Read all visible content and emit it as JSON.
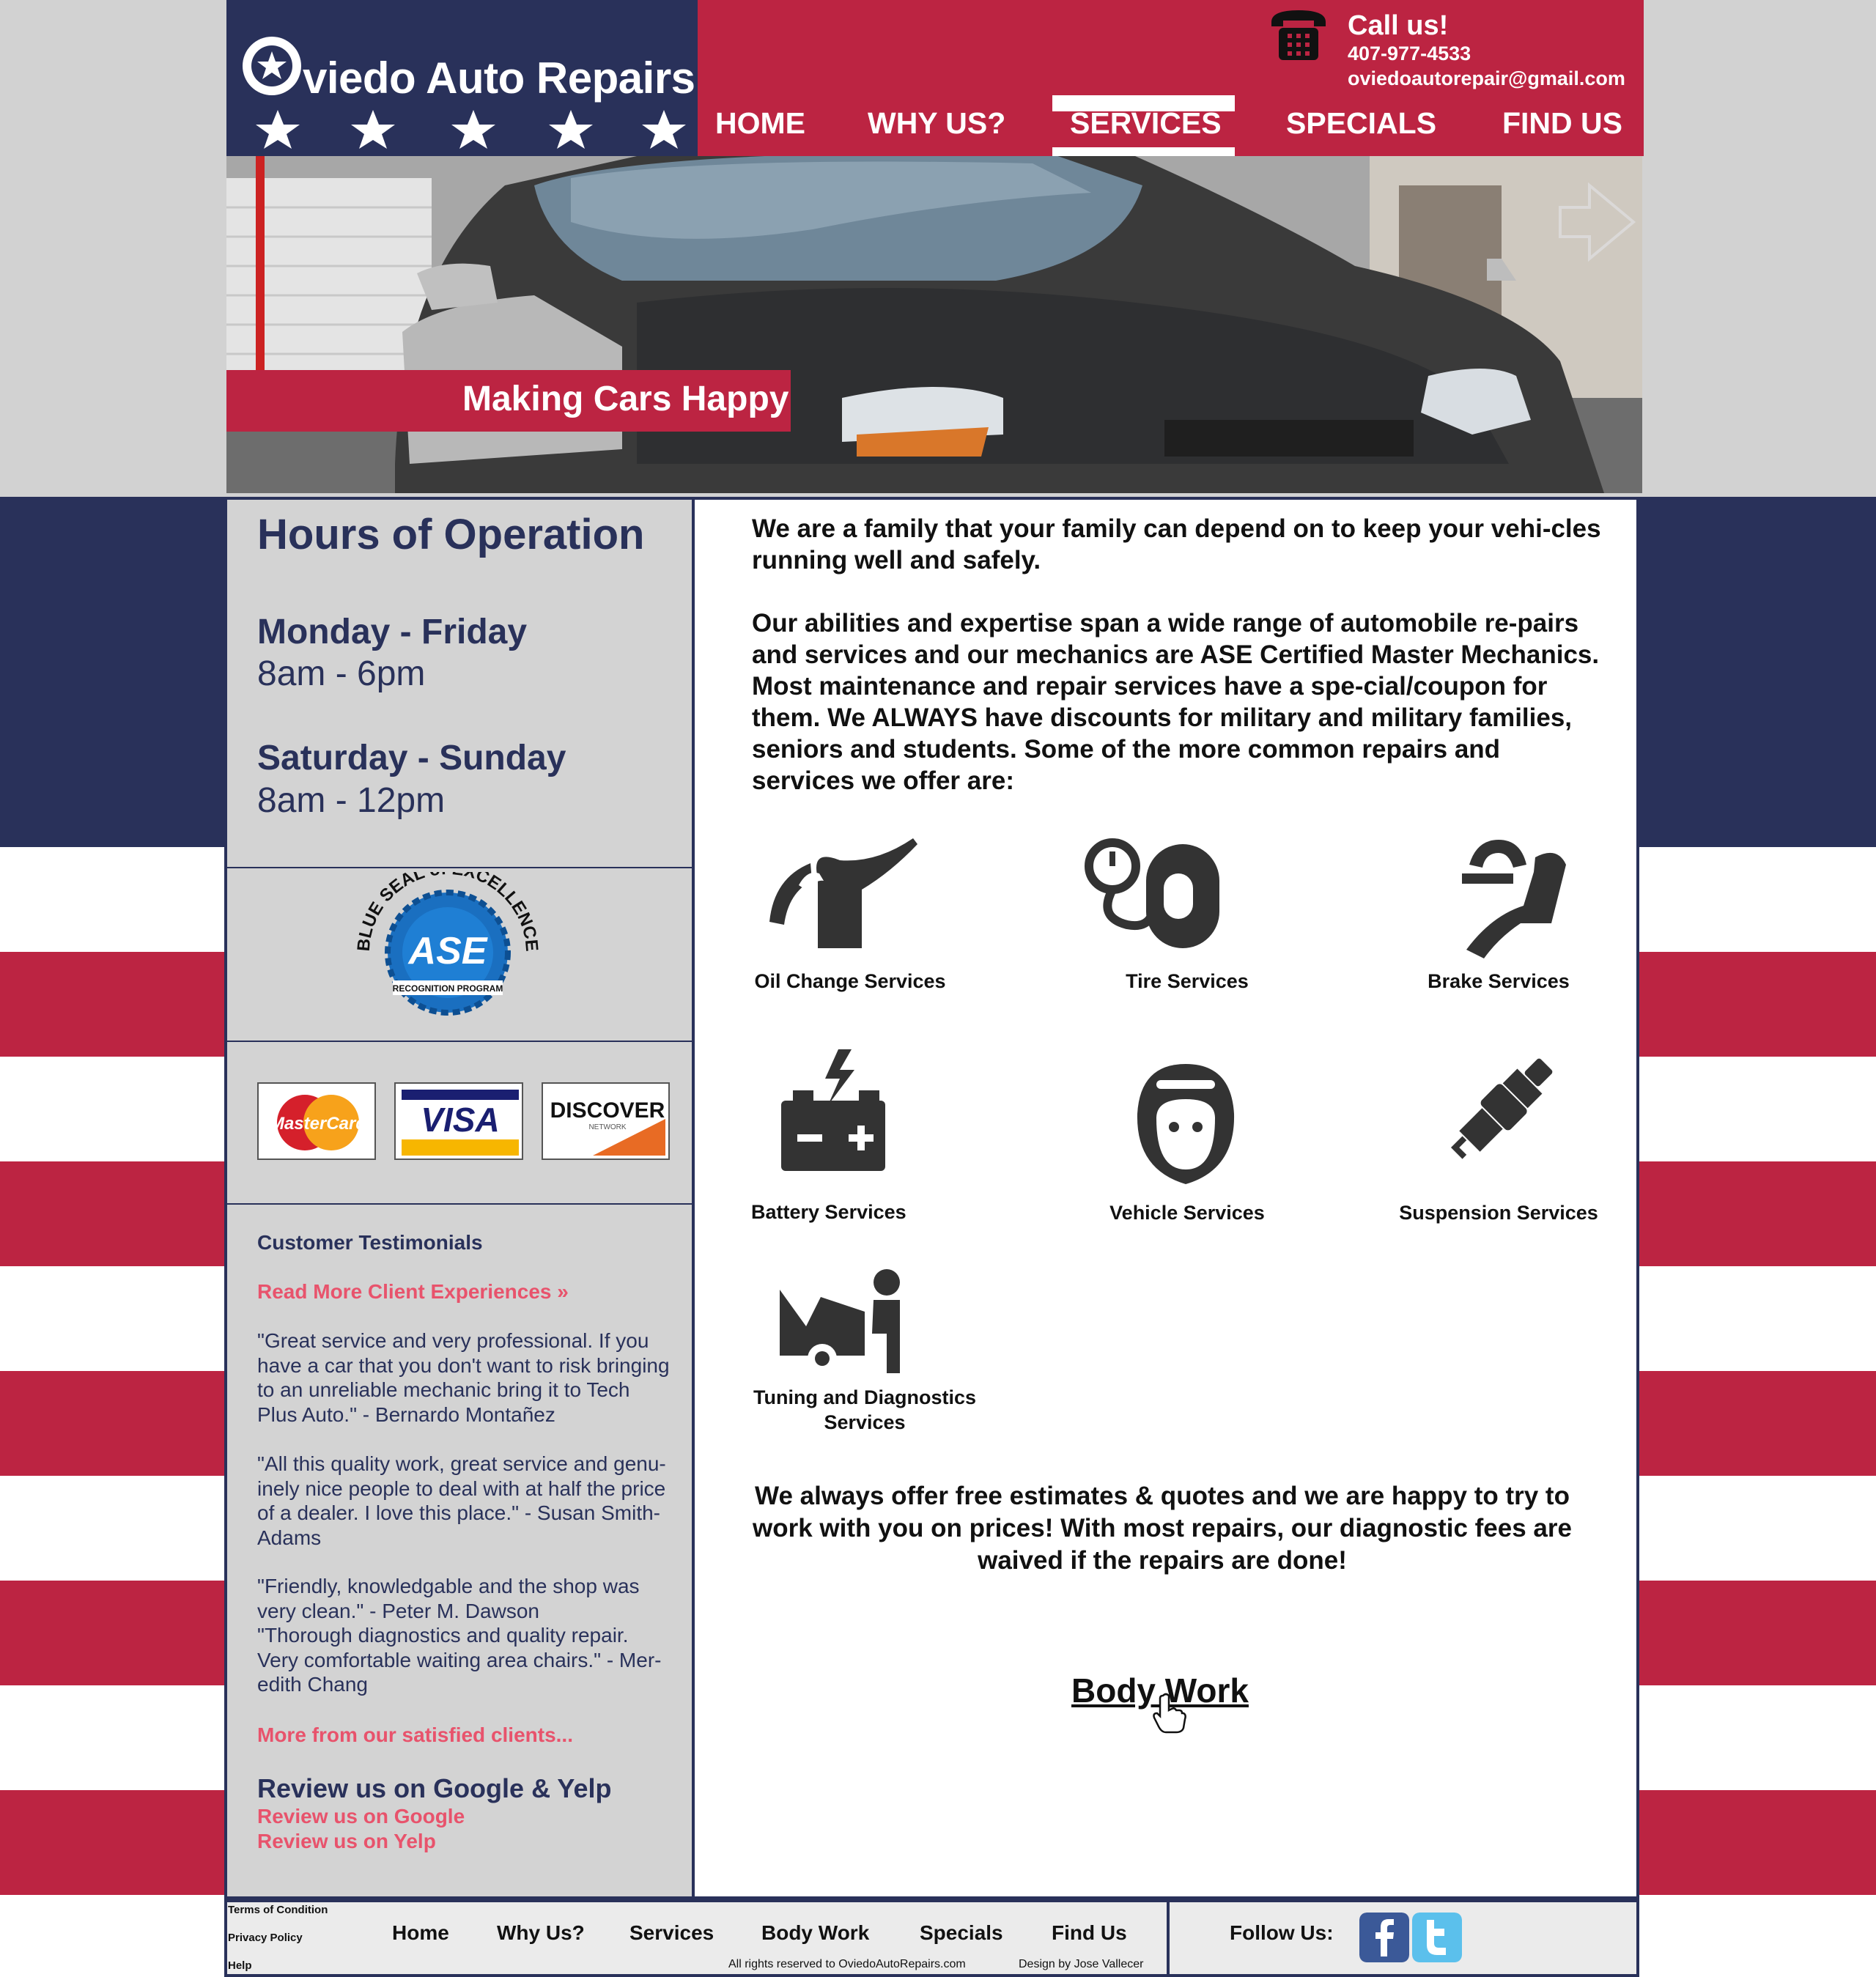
{
  "header": {
    "logo_text": "viedo Auto Repairs",
    "call_title": "Call us!",
    "phone": "407-977-4533",
    "email": "oviedoautorepair@gmail.com",
    "nav": [
      "HOME",
      "WHY US?",
      "SERVICES",
      "SPECIALS",
      "FIND US"
    ],
    "active_nav": "SERVICES"
  },
  "hero": {
    "tagline": "Making Cars Happy"
  },
  "sidebar": {
    "hours_title": "Hours of Operation",
    "weekday_label": "Monday - Friday",
    "weekday_hours": "8am - 6pm",
    "weekend_label": "Saturday - Sunday",
    "weekend_hours": "8am - 12pm",
    "seal_text": "BLUE SEAL of EXCELLENCE",
    "seal_sub": "RECOGNITION PROGRAM",
    "cards": [
      "MasterCard",
      "VISA",
      "DISCOVER"
    ],
    "discover_sub": "NETWORK",
    "testimonials_title": "Customer Testimonials",
    "read_more": "Read More Client Experiences »",
    "quotes": [
      "\"Great service and very professional. If you have a car that you don't want to risk bringing to an unreliable mechanic bring it to Tech Plus Auto.\" - Bernardo Montañez",
      "\"All this quality work, great service and genu-inely nice people to deal with at half the price of a dealer. I love this place.\" - Susan Smith-Adams",
      "\"Friendly, knowledgable and the shop was very clean.\" - Peter M. Dawson",
      "\"Thorough diagnostics and quality repair. Very comfortable waiting area chairs.\" - Mer-edith Chang"
    ],
    "more_clients": "More from our satisfied clients...",
    "review_title": "Review us on Google & Yelp",
    "review_google": "Review us on Google",
    "review_yelp": "Review us on Yelp"
  },
  "main": {
    "intro_1": "We are a family that your family can depend on to keep your vehi-cles running well and safely.",
    "intro_2": "Our abilities and expertise span a wide range of automobile re-pairs and services and our mechanics are ASE Certified Master Mechanics. Most maintenance and repair services have a spe-cial/coupon for them. We ALWAYS have discounts for military and military families, seniors and students. Some of the more common repairs and services we offer are:",
    "services": [
      {
        "label": "Oil Change Services",
        "icon": "oil-can-icon"
      },
      {
        "label": "Tire Services",
        "icon": "tire-gauge-icon"
      },
      {
        "label": "Brake Services",
        "icon": "brake-icon"
      },
      {
        "label": "Battery Services",
        "icon": "battery-icon"
      },
      {
        "label": "Vehicle Services",
        "icon": "mechanic-icon"
      },
      {
        "label": "Suspension Services",
        "icon": "spark-plug-icon"
      },
      {
        "label": "Tuning and Diagnostics Services",
        "icon": "car-repair-icon"
      }
    ],
    "estimate": "We always offer free estimates & quotes and we are happy to try to work with you on prices! With most repairs, our diagnostic fees are waived if the repairs are done!",
    "body_work": "Body Work"
  },
  "footer": {
    "terms": "Terms of Condition",
    "privacy": "Privacy Policy",
    "help": "Help",
    "nav": [
      "Home",
      "Why Us?",
      "Services",
      "Body Work",
      "Specials",
      "Find Us"
    ],
    "rights": "All rights reserved to OviedoAutoRepairs.com",
    "design": "Design by Jose Vallecer",
    "follow": "Follow Us:"
  },
  "colors": {
    "navy": "#29315a",
    "red": "#bc2442",
    "pink_link": "#e8536c",
    "sidebar_gray": "#d3d3d3"
  }
}
